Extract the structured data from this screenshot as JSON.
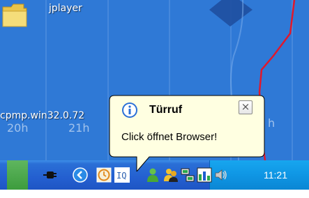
{
  "desktop": {
    "icons": [
      {
        "label": "jplayer"
      },
      {
        "label": "cpmp.win32.0.72"
      }
    ],
    "hour_marks": [
      "20h",
      "21h",
      "h"
    ]
  },
  "balloon": {
    "title": "Türruf",
    "text": "Click öffnet Browser!",
    "close_glyph": "×",
    "icon": "info-icon"
  },
  "taskbar": {
    "icons": [
      "plug-icon",
      "back-arrow-icon",
      "clock-app-icon",
      "tq-icon"
    ],
    "tray_icons": [
      "user-icon",
      "people-icon",
      "network-icon",
      "chart-icon",
      "speaker-icon"
    ],
    "clock": "11:21"
  },
  "colors": {
    "desktop": "#2f79d6",
    "taskbar": "#245fd0",
    "tray": "#0f96e4",
    "balloon": "#ffffe1",
    "accent_line": "#e0182c"
  }
}
